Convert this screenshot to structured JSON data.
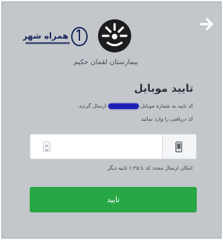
{
  "hospital_name": "بیمارستان لقمان حکیم",
  "watermark_text": "همراه شهر",
  "form": {
    "title": "تایید موبایل",
    "sent_message_before": "کد تایید به شماره موبایل",
    "sent_message_after": "ارسال گردید.",
    "enter_message": "کد دریافتی را وارد نمائید",
    "code_value": "",
    "resend_text": "امکان ارسال مجدد کد تا ۱:۲۵ ثانیه دیگر",
    "submit_label": "تایید"
  },
  "colors": {
    "panel": "#c3c6cb",
    "accent": "#28a745",
    "redaction": "#1f1fb8"
  },
  "icons": {
    "back": "arrow-right-icon",
    "mobile": "mobile-phone-icon"
  }
}
